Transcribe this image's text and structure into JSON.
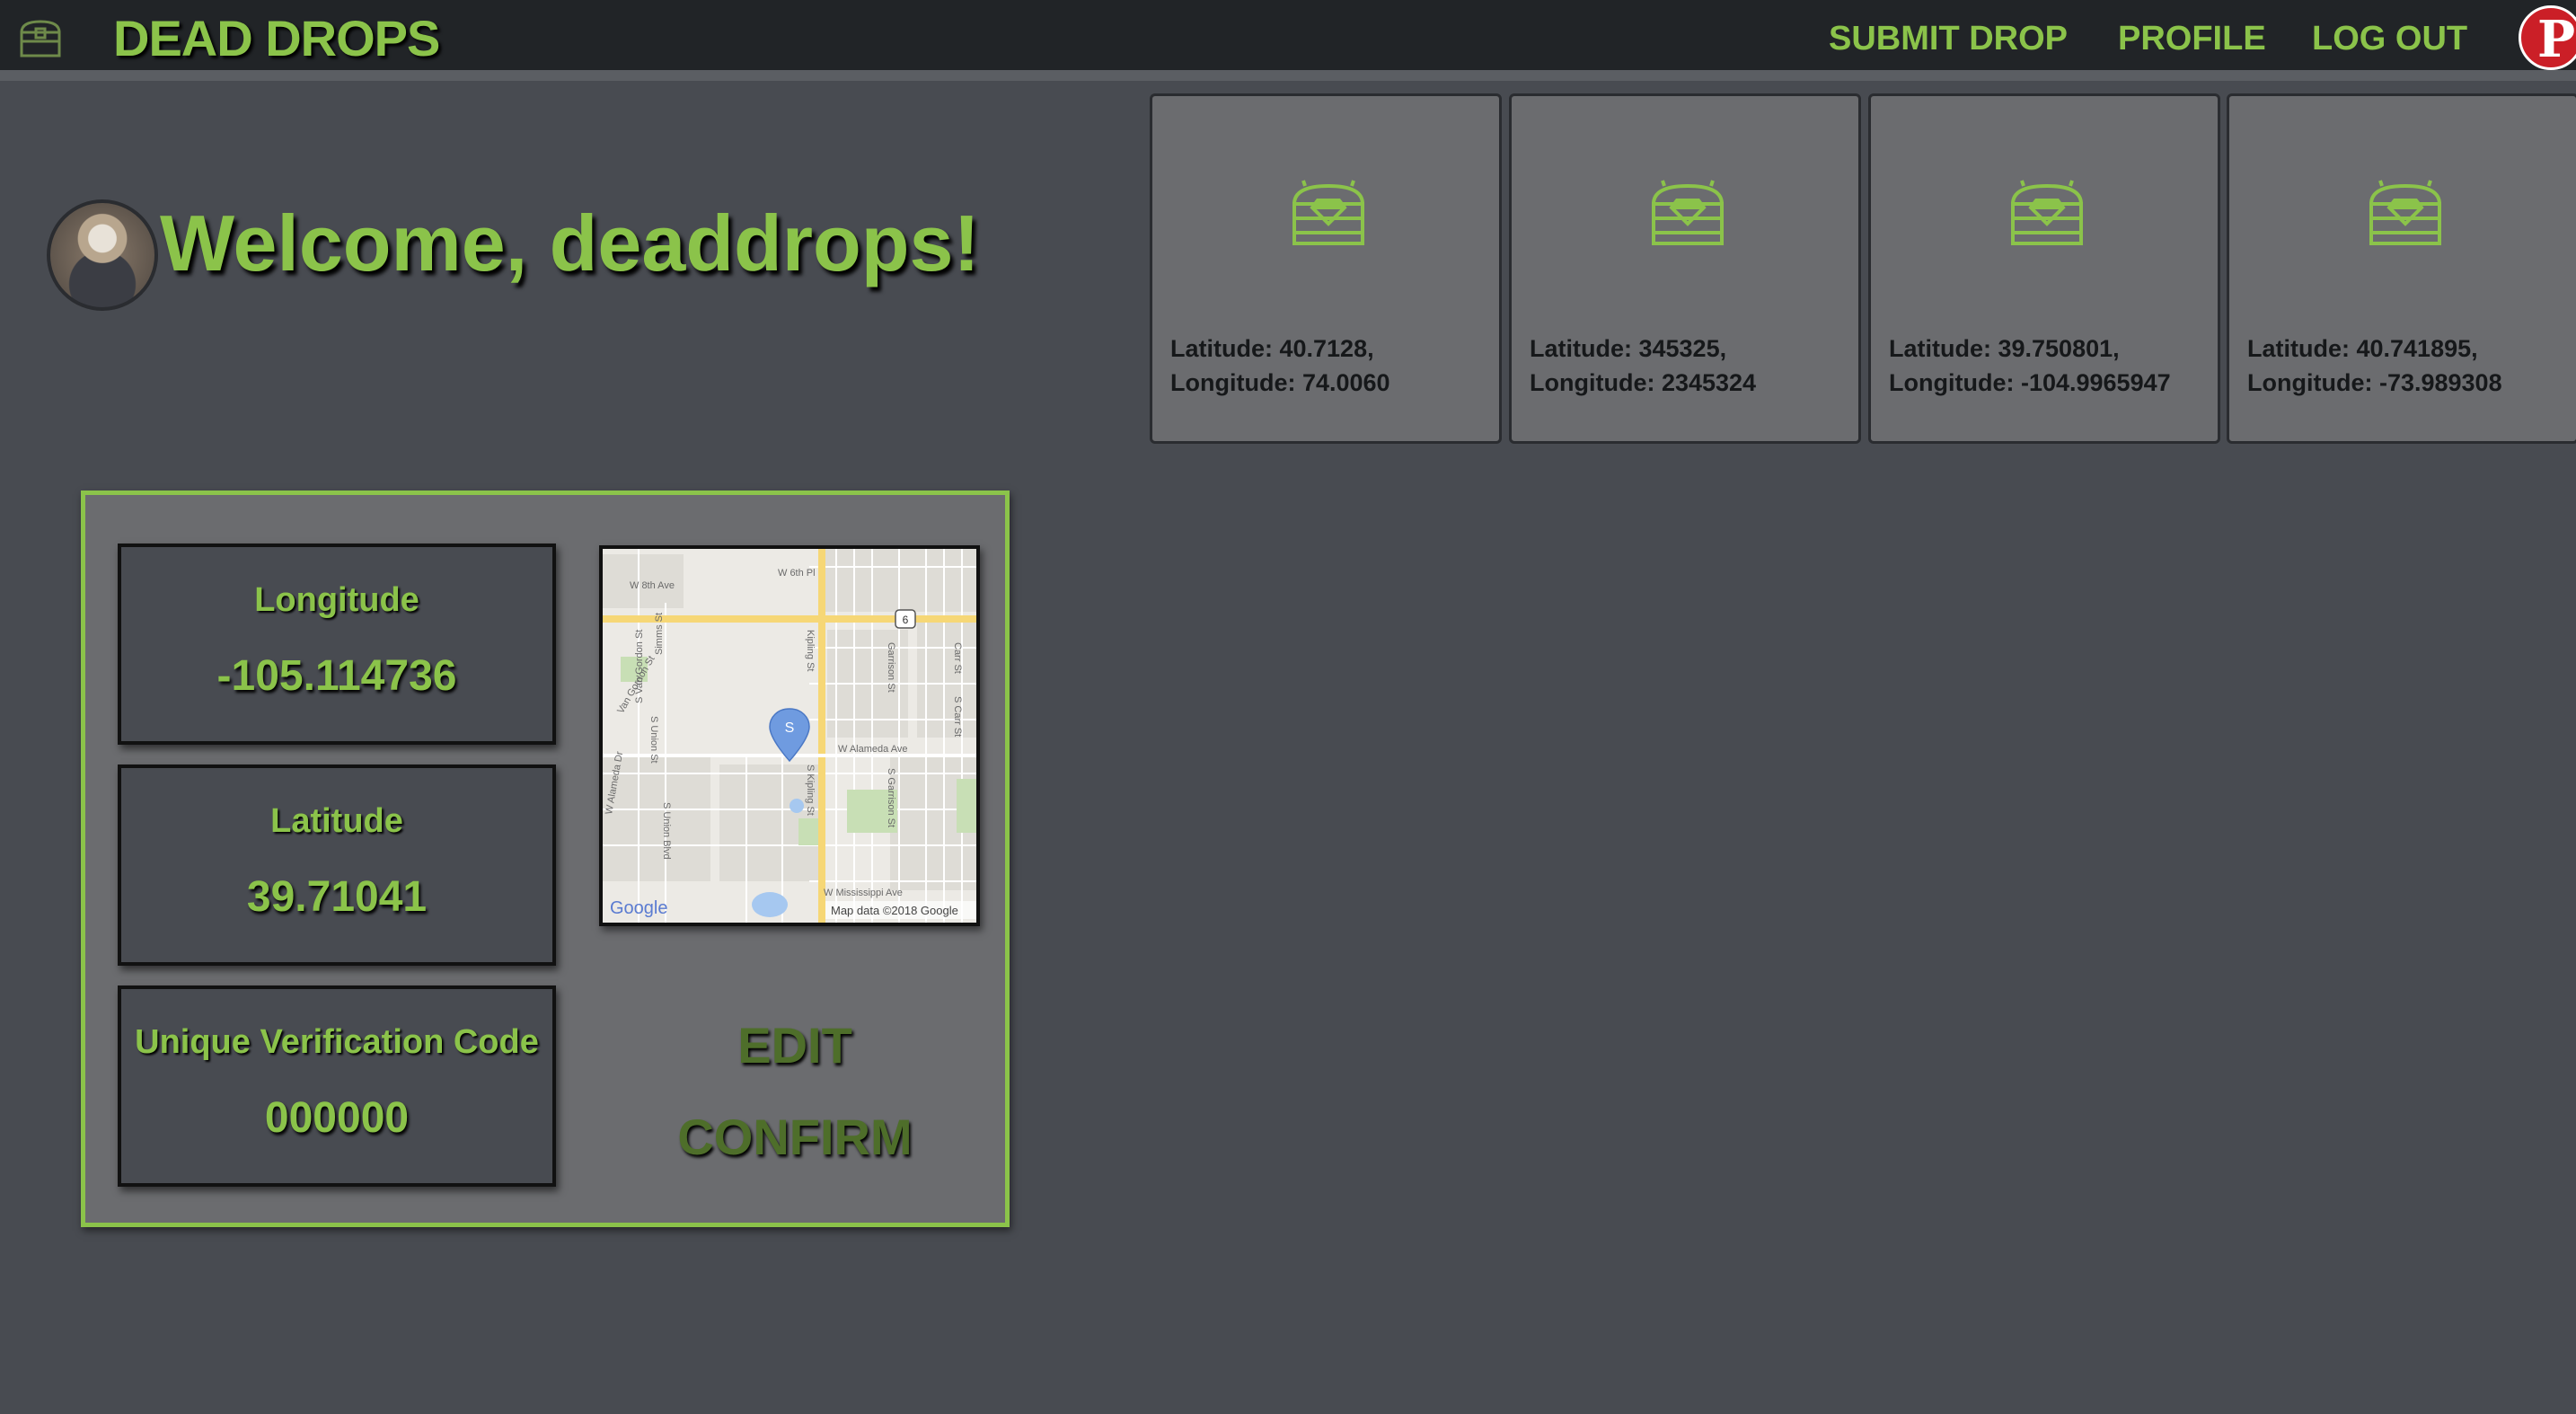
{
  "header": {
    "brand": "DEAD DROPS",
    "logo_icon": "treasure-chest-icon",
    "nav": {
      "submit_drop": "SUBMIT DROP",
      "profile": "PROFILE",
      "log_out": "LOG OUT"
    },
    "social_icon": "pinterest-icon"
  },
  "welcome": {
    "text": "Welcome, deaddrops!",
    "avatar_icon": "user-avatar"
  },
  "drops": [
    {
      "latitude": "Latitude: 40.7128,",
      "longitude": "Longitude: 74.0060"
    },
    {
      "latitude": "Latitude: 345325,",
      "longitude": "Longitude: 2345324"
    },
    {
      "latitude": "Latitude: 39.750801,",
      "longitude": "Longitude: -104.9965947"
    },
    {
      "latitude": "Latitude: 40.741895,",
      "longitude": "Longitude: -73.989308"
    }
  ],
  "submission": {
    "longitude_label": "Longitude",
    "longitude_value": "-105.114736",
    "latitude_label": "Latitude",
    "latitude_value": "39.71041",
    "code_label": "Unique Verification Code",
    "code_value": "000000",
    "edit": "EDIT",
    "confirm": "CONFIRM"
  },
  "map": {
    "marker": "S",
    "attribution": "Map data ©2018 Google",
    "logo": "Google",
    "route_shield": "6",
    "streets": {
      "w_8th": "W 8th Ave",
      "w_6th": "W 6th Pl",
      "kipling": "Kipling St",
      "s_kipling": "S Kipling St",
      "w_alameda": "W Alameda Ave",
      "w_mississippi": "W Mississippi Ave",
      "garrison": "Garrison St",
      "s_garrison": "S Garrison St",
      "carr": "Carr St",
      "s_carr": "S Carr St",
      "union": "S Union St",
      "union_blvd": "S Union Blvd",
      "van_gordon": "Van Gordon St",
      "s_van_gordon": "S Van Gordon St",
      "w_alameda_dr": "W Alameda Dr",
      "simms": "Simms St"
    }
  },
  "colors": {
    "accent": "#8bc34a",
    "background": "#484b51",
    "nav": "#212427",
    "card": "#6b6c6f",
    "pinterest": "#cb1f27"
  }
}
